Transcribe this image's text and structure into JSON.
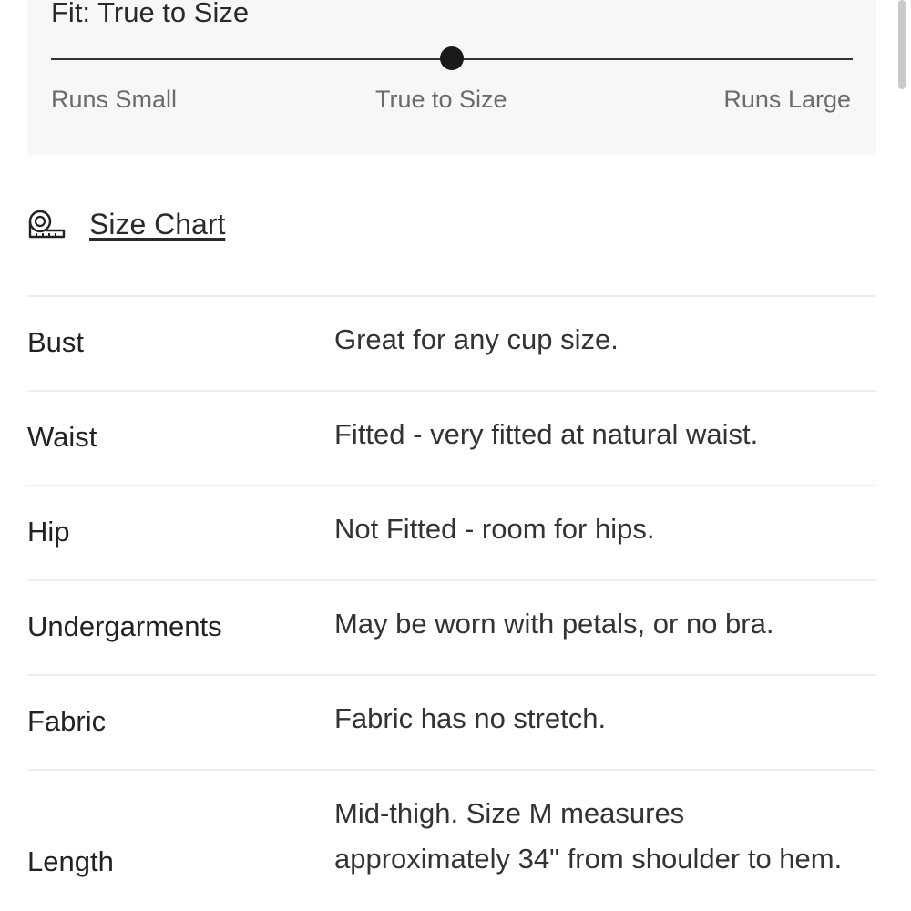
{
  "fit": {
    "title": "Fit: True to Size",
    "scale_left": "Runs Small",
    "scale_center": "True to Size",
    "scale_right": "Runs Large",
    "level": 0.5
  },
  "size_chart": {
    "label": "Size Chart",
    "icon": "measuring-tape-icon"
  },
  "specs": {
    "bust": {
      "label": "Bust",
      "value": "Great for any cup size."
    },
    "waist": {
      "label": "Waist",
      "value": "Fitted - very fitted at natural waist."
    },
    "hip": {
      "label": "Hip",
      "value": "Not Fitted - room for hips."
    },
    "undergarments": {
      "label": "Undergarments",
      "value": "May be worn with petals, or no bra."
    },
    "fabric": {
      "label": "Fabric",
      "value": "Fabric has no stretch."
    },
    "length": {
      "label": "Length",
      "value": "Mid-thigh. Size M measures approximately 34\" from shoulder to hem."
    }
  },
  "colors": {
    "panel_bg": "#f7f7f7",
    "text": "#222222",
    "muted": "#6b6b6b",
    "divider": "#eeeeee"
  }
}
